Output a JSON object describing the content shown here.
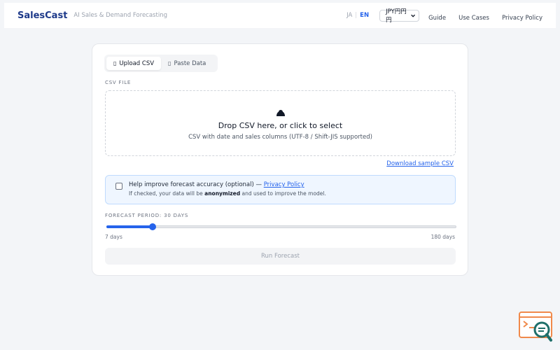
{
  "header": {
    "brand": "SalesCast",
    "tagline": "AI Sales & Demand Forecasting",
    "lang": {
      "ja": "JA",
      "separator": "|",
      "en": "EN",
      "active": "en"
    },
    "currency": {
      "selected": "JPY円円円"
    },
    "nav": [
      "Guide",
      "Use Cases",
      "Privacy Policy"
    ]
  },
  "tabs": [
    {
      "icon": "upload-icon",
      "glyph": "▯",
      "label": "Upload CSV",
      "active": true
    },
    {
      "icon": "paste-icon",
      "glyph": "▯",
      "label": "Paste Data",
      "active": false
    }
  ],
  "upload": {
    "field_label": "CSV FILE",
    "drop_title": "Drop CSV here, or click to select",
    "drop_subtitle": "CSV with date and sales columns (UTF-8 / Shift-JIS supported)",
    "icon": "cloud-icon",
    "sample_link": "Download sample CSV"
  },
  "consent": {
    "checked": false,
    "text": "Help improve forecast accuracy (optional) —",
    "link": "Privacy Policy",
    "note_before": "If checked, your data will be",
    "note_bold": "anonymized",
    "note_after": "and used to improve the model."
  },
  "forecast": {
    "label": "FORECAST PERIOD: 30 DAYS",
    "min_label": "7 days",
    "max_label": "180 days",
    "min": 7,
    "max": 180,
    "value": 30
  },
  "run_button": {
    "label": "Run Forecast",
    "disabled": true
  },
  "colors": {
    "accent": "#2563eb",
    "brand": "#1e3a8a",
    "helper_orange": "#f08a4b",
    "helper_teal": "#1f6f6a"
  }
}
